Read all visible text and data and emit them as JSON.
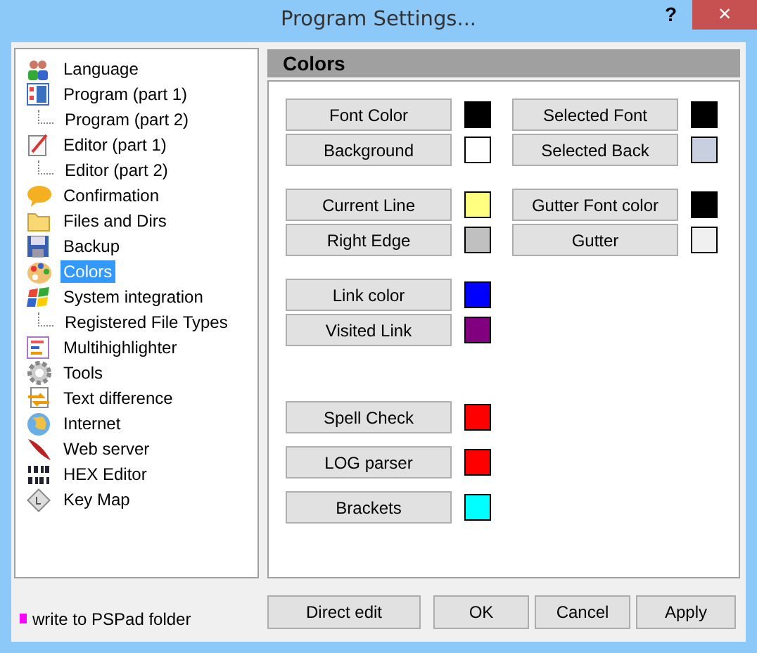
{
  "window": {
    "title": "Program Settings...",
    "help": "?",
    "close": "×"
  },
  "sidebar": {
    "items": [
      {
        "label": "Language",
        "selected": false
      },
      {
        "label": "Program  (part 1)",
        "selected": false,
        "children": [
          {
            "label": "Program  (part 2)",
            "selected": false
          }
        ]
      },
      {
        "label": "Editor  (part 1)",
        "selected": false,
        "children": [
          {
            "label": "Editor  (part 2)",
            "selected": false
          }
        ]
      },
      {
        "label": "Confirmation",
        "selected": false
      },
      {
        "label": "Files and Dirs",
        "selected": false
      },
      {
        "label": "Backup",
        "selected": false
      },
      {
        "label": "Colors",
        "selected": true
      },
      {
        "label": "System integration",
        "selected": false,
        "children": [
          {
            "label": "Registered File Types",
            "selected": false
          }
        ]
      },
      {
        "label": "Multihighlighter",
        "selected": false
      },
      {
        "label": "Tools",
        "selected": false
      },
      {
        "label": "Text difference",
        "selected": false
      },
      {
        "label": "Internet",
        "selected": false
      },
      {
        "label": "Web server",
        "selected": false
      },
      {
        "label": "HEX Editor",
        "selected": false
      },
      {
        "label": "Key Map",
        "selected": false
      }
    ]
  },
  "panel": {
    "title": "Colors",
    "groups": [
      {
        "kind": "pair",
        "rows": [
          [
            {
              "label": "Font Color",
              "color": "#000000"
            },
            {
              "label": "Selected Font",
              "color": "#000000"
            }
          ],
          [
            {
              "label": "Background",
              "color": "#ffffff"
            },
            {
              "label": "Selected Back",
              "color": "#c8d0e0"
            }
          ]
        ]
      },
      {
        "kind": "pair",
        "rows": [
          [
            {
              "label": "Current Line",
              "color": "#ffff80"
            },
            {
              "label": "Gutter Font color",
              "color": "#000000"
            }
          ],
          [
            {
              "label": "Right Edge",
              "color": "#c0c0c0"
            },
            {
              "label": "Gutter",
              "color": "#f0f0f0"
            }
          ]
        ]
      },
      {
        "kind": "pair",
        "rows": [
          [
            {
              "label": "Link color",
              "color": "#0000ff"
            }
          ],
          [
            {
              "label": "Visited Link",
              "color": "#800080"
            }
          ]
        ]
      },
      {
        "kind": "spaced",
        "rows": [
          [
            {
              "label": "Spell Check",
              "color": "#ff0000"
            }
          ],
          [
            {
              "label": "LOG parser",
              "color": "#ff0000"
            }
          ],
          [
            {
              "label": "Brackets",
              "color": "#00ffff"
            }
          ]
        ]
      }
    ]
  },
  "footer": {
    "note": "write to PSPad folder",
    "buttons": [
      "Direct edit",
      "OK",
      "Cancel",
      "Apply"
    ]
  }
}
